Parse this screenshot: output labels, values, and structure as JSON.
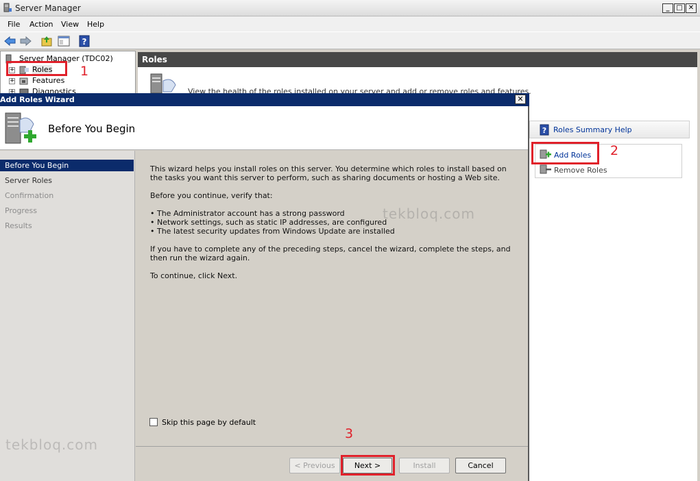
{
  "window": {
    "title": "Server Manager"
  },
  "menu": [
    "File",
    "Action",
    "View",
    "Help"
  ],
  "tree": {
    "root": "Server Manager (TDC02)",
    "items": [
      "Roles",
      "Features",
      "Diagnostics"
    ]
  },
  "roles_pane": {
    "header": "Roles",
    "description": "View the health of the roles installed on your server and add or remove roles and features."
  },
  "actions": {
    "summary_help": "Roles Summary Help",
    "add_roles": "Add Roles",
    "remove_roles": "Remove Roles"
  },
  "wizard": {
    "title": "Add Roles Wizard",
    "heading": "Before You Begin",
    "nav": [
      "Before You Begin",
      "Server Roles",
      "Confirmation",
      "Progress",
      "Results"
    ],
    "para1": "This wizard helps you install roles on this server. You determine which roles to install based on the tasks you want this server to perform, such as sharing documents or hosting a Web site.",
    "para2": "Before you continue, verify that:",
    "bullets": [
      "• The Administrator account has a strong password",
      "• Network settings, such as static IP addresses, are configured",
      "• The latest security updates from Windows Update are installed"
    ],
    "para3": "If you have to complete any of the preceding steps, cancel the wizard, complete the steps, and then run the wizard again.",
    "para4": "To continue, click Next.",
    "skip_label": "Skip this page by default",
    "buttons": {
      "previous": "< Previous",
      "next": "Next >",
      "install": "Install",
      "cancel": "Cancel"
    }
  },
  "annotations": {
    "one": "1",
    "two": "2",
    "three": "3"
  },
  "watermark": "tekbloq.com",
  "colors": {
    "title_bar": "#0b2b6b",
    "annotation": "#e0202a",
    "link": "#003399"
  }
}
